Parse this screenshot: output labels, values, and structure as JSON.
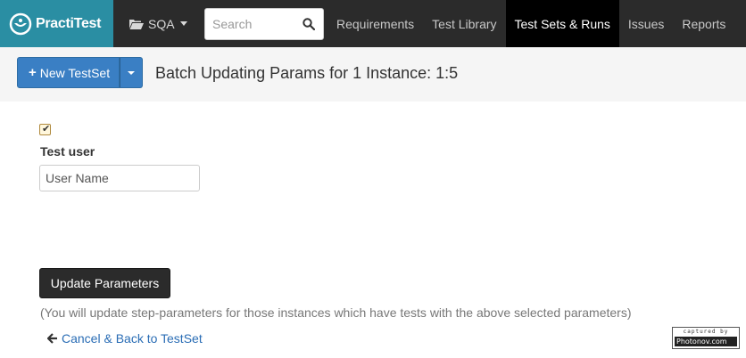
{
  "brand": {
    "name": "PractiTest",
    "color": "#2a8ea3"
  },
  "project": {
    "label": "SQA",
    "icon": "folder-open-icon"
  },
  "search": {
    "placeholder": "Search",
    "value": ""
  },
  "nav": {
    "items": [
      {
        "label": "Requirements",
        "active": false
      },
      {
        "label": "Test Library",
        "active": false
      },
      {
        "label": "Test Sets & Runs",
        "active": true
      },
      {
        "label": "Issues",
        "active": false
      },
      {
        "label": "Reports",
        "active": false
      }
    ]
  },
  "subheader": {
    "new_button_label": "New TestSet",
    "title": "Batch Updating Params for 1 Instance: 1:5"
  },
  "form": {
    "checkbox_checked": true,
    "param_label": "Test user",
    "param_value": "User Name",
    "update_button_label": "Update Parameters",
    "note": "(You will update step-parameters for those instances which have tests with the above selected parameters)",
    "cancel_link": "Cancel & Back to TestSet"
  },
  "watermark": {
    "top": "captured by",
    "bottom": "Photonov.com"
  },
  "colors": {
    "accent": "#3a7fc4",
    "nav_bg": "#2b2b2b",
    "link": "#2a6db5"
  }
}
